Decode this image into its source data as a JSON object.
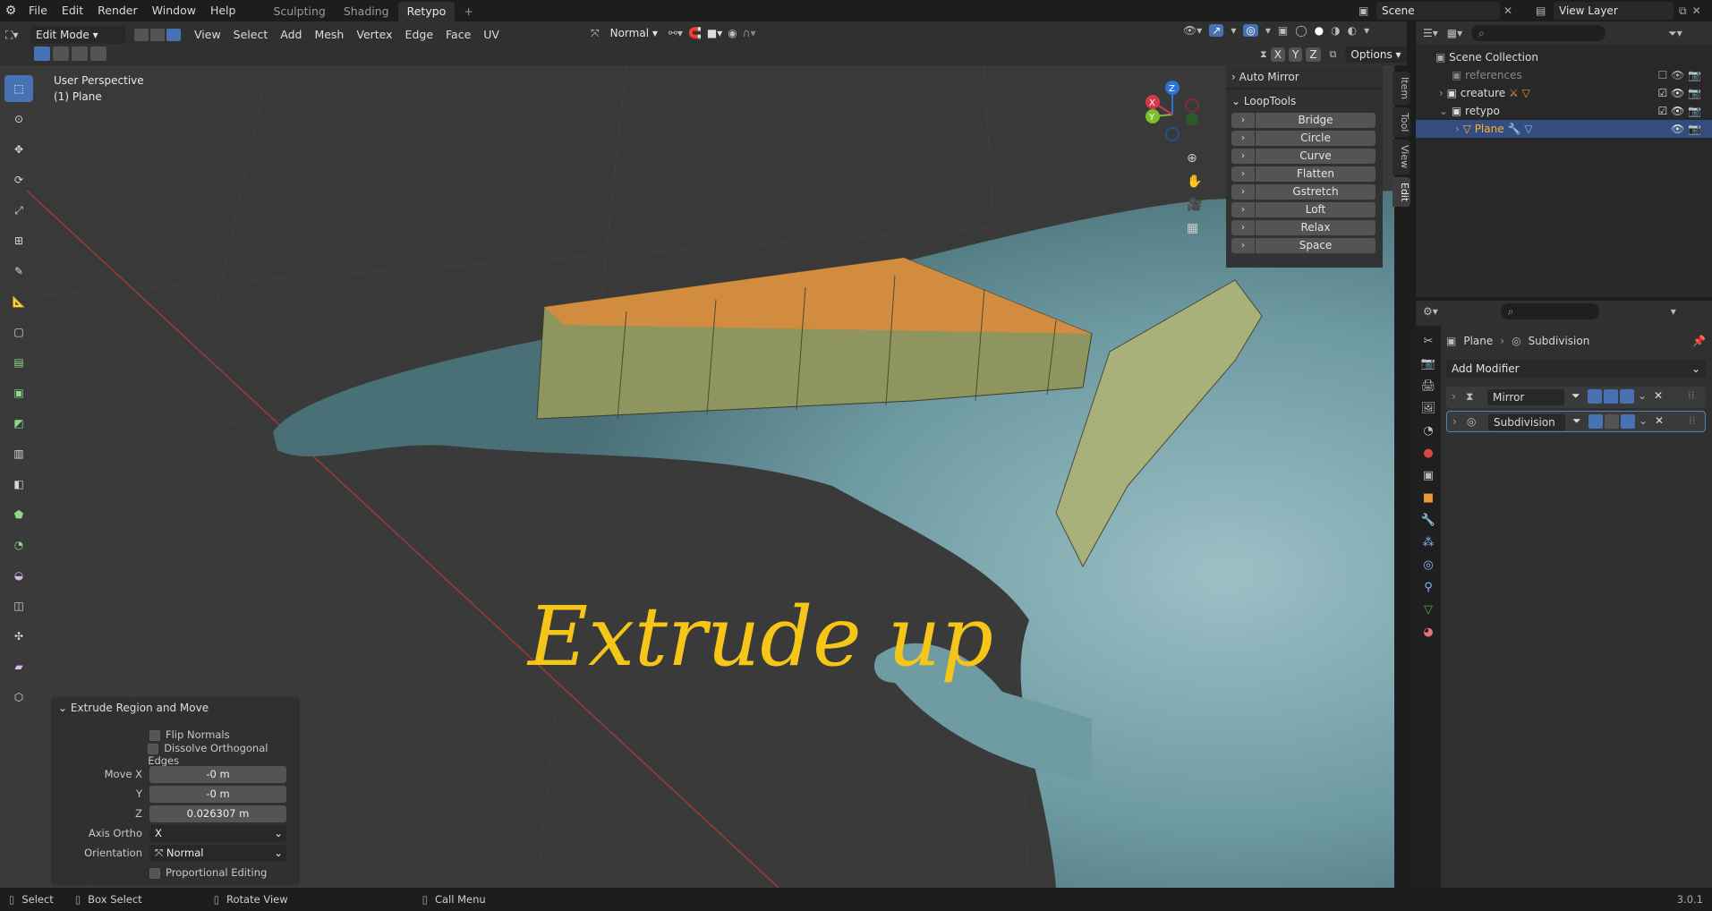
{
  "topbar": {
    "menus": [
      "File",
      "Edit",
      "Render",
      "Window",
      "Help"
    ],
    "workspaces": [
      "Sculpting",
      "Shading",
      "Retypo"
    ],
    "add_tab": "+",
    "scene": "Scene",
    "view_layer": "View Layer"
  },
  "header": {
    "mode": "Edit Mode",
    "menus": [
      "View",
      "Select",
      "Add",
      "Mesh",
      "Vertex",
      "Edge",
      "Face",
      "UV"
    ],
    "orientation": "Normal",
    "axes": [
      "X",
      "Y",
      "Z"
    ],
    "options": "Options"
  },
  "viewport": {
    "perspective": "User Perspective",
    "object": "(1) Plane",
    "annotation": "Extrude up",
    "gizmo": {
      "z": "Z",
      "y": "Y",
      "x": "X"
    }
  },
  "npanel": {
    "auto_mirror": "Auto Mirror",
    "looptools": "LoopTools",
    "buttons": [
      "Bridge",
      "Circle",
      "Curve",
      "Flatten",
      "Gstretch",
      "Loft",
      "Relax",
      "Space"
    ],
    "tabs": [
      "Item",
      "Tool",
      "View",
      "Edit"
    ]
  },
  "operator": {
    "title": "Extrude Region and Move",
    "flip_normals": "Flip Normals",
    "dissolve": "Dissolve Orthogonal Edges",
    "move_x_label": "Move X",
    "move_x": "-0 m",
    "y_label": "Y",
    "y": "-0 m",
    "z_label": "Z",
    "z": "0.026307 m",
    "axis_ortho_label": "Axis Ortho",
    "axis_ortho": "X",
    "orientation_label": "Orientation",
    "orientation": "Normal",
    "proportional": "Proportional Editing"
  },
  "outliner": {
    "scene_collection": "Scene Collection",
    "items": [
      {
        "name": "references"
      },
      {
        "name": "creature"
      },
      {
        "name": "retypo"
      },
      {
        "name": "Plane"
      }
    ]
  },
  "properties": {
    "breadcrumb_object": "Plane",
    "breadcrumb_modifier": "Subdivision",
    "add_modifier": "Add Modifier",
    "modifiers": [
      "Mirror",
      "Subdivision"
    ]
  },
  "status": {
    "select": "Select",
    "box_select": "Box Select",
    "rotate": "Rotate View",
    "call_menu": "Call Menu",
    "version": "3.0.1"
  },
  "colors": {
    "accent": "#4772b3",
    "annotation": "#f5c518",
    "selected_orange": "#e8973a"
  }
}
